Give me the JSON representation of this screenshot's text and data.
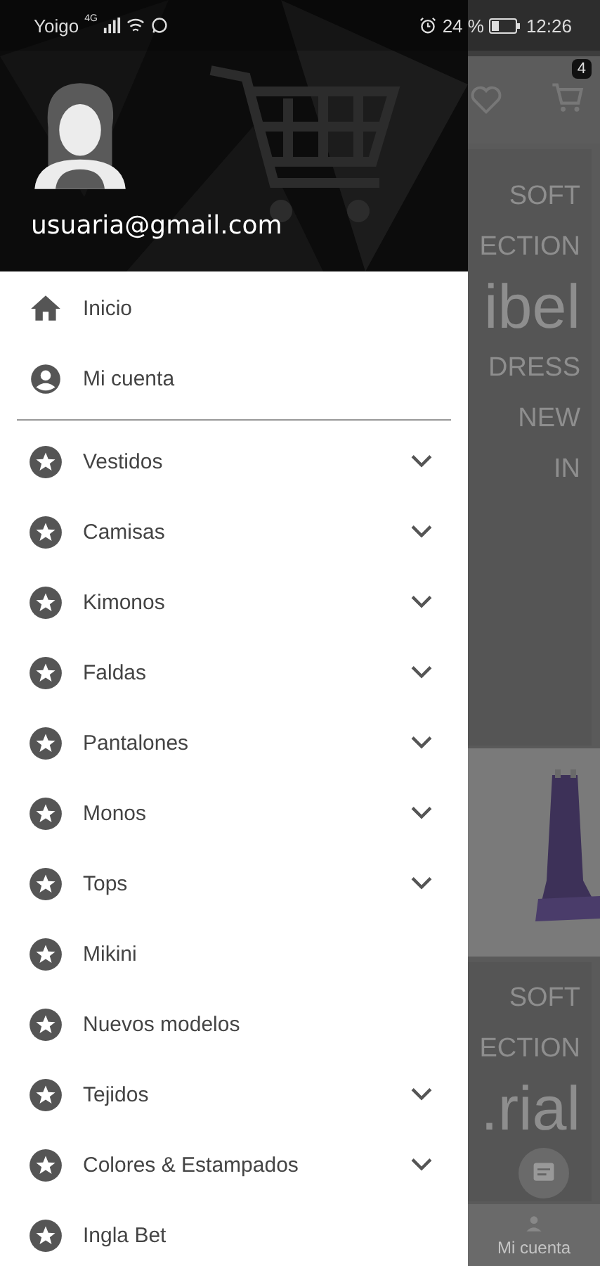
{
  "status_bar": {
    "carrier": "Yoigo",
    "network": "4G",
    "battery": "24 %",
    "time": "12:26"
  },
  "drawer": {
    "user": {
      "email": "usuaria@gmail.com"
    },
    "nav": [
      {
        "label": "Inicio",
        "kind": "home"
      },
      {
        "label": "Mi cuenta",
        "kind": "account"
      }
    ],
    "categories": [
      {
        "label": "Vestidos",
        "expandable": true
      },
      {
        "label": "Camisas",
        "expandable": true
      },
      {
        "label": "Kimonos",
        "expandable": true
      },
      {
        "label": "Faldas",
        "expandable": true
      },
      {
        "label": "Pantalones",
        "expandable": true
      },
      {
        "label": "Monos",
        "expandable": true
      },
      {
        "label": "Tops",
        "expandable": true
      },
      {
        "label": "Mikini",
        "expandable": false
      },
      {
        "label": "Nuevos modelos",
        "expandable": false
      },
      {
        "label": "Tejidos",
        "expandable": true
      },
      {
        "label": "Colores & Estampados",
        "expandable": true
      },
      {
        "label": "Ingla Bet",
        "expandable": false
      }
    ]
  },
  "background": {
    "cart_badge": "4",
    "banners": [
      {
        "lines": [
          "SOFT",
          "ECTION",
          "ibel",
          "DRESS",
          "NEW",
          "IN"
        ]
      },
      {
        "lines": [
          "SOFT",
          "ECTION",
          ".rial"
        ]
      }
    ],
    "bottom_nav": {
      "label": "Mi cuenta"
    }
  }
}
